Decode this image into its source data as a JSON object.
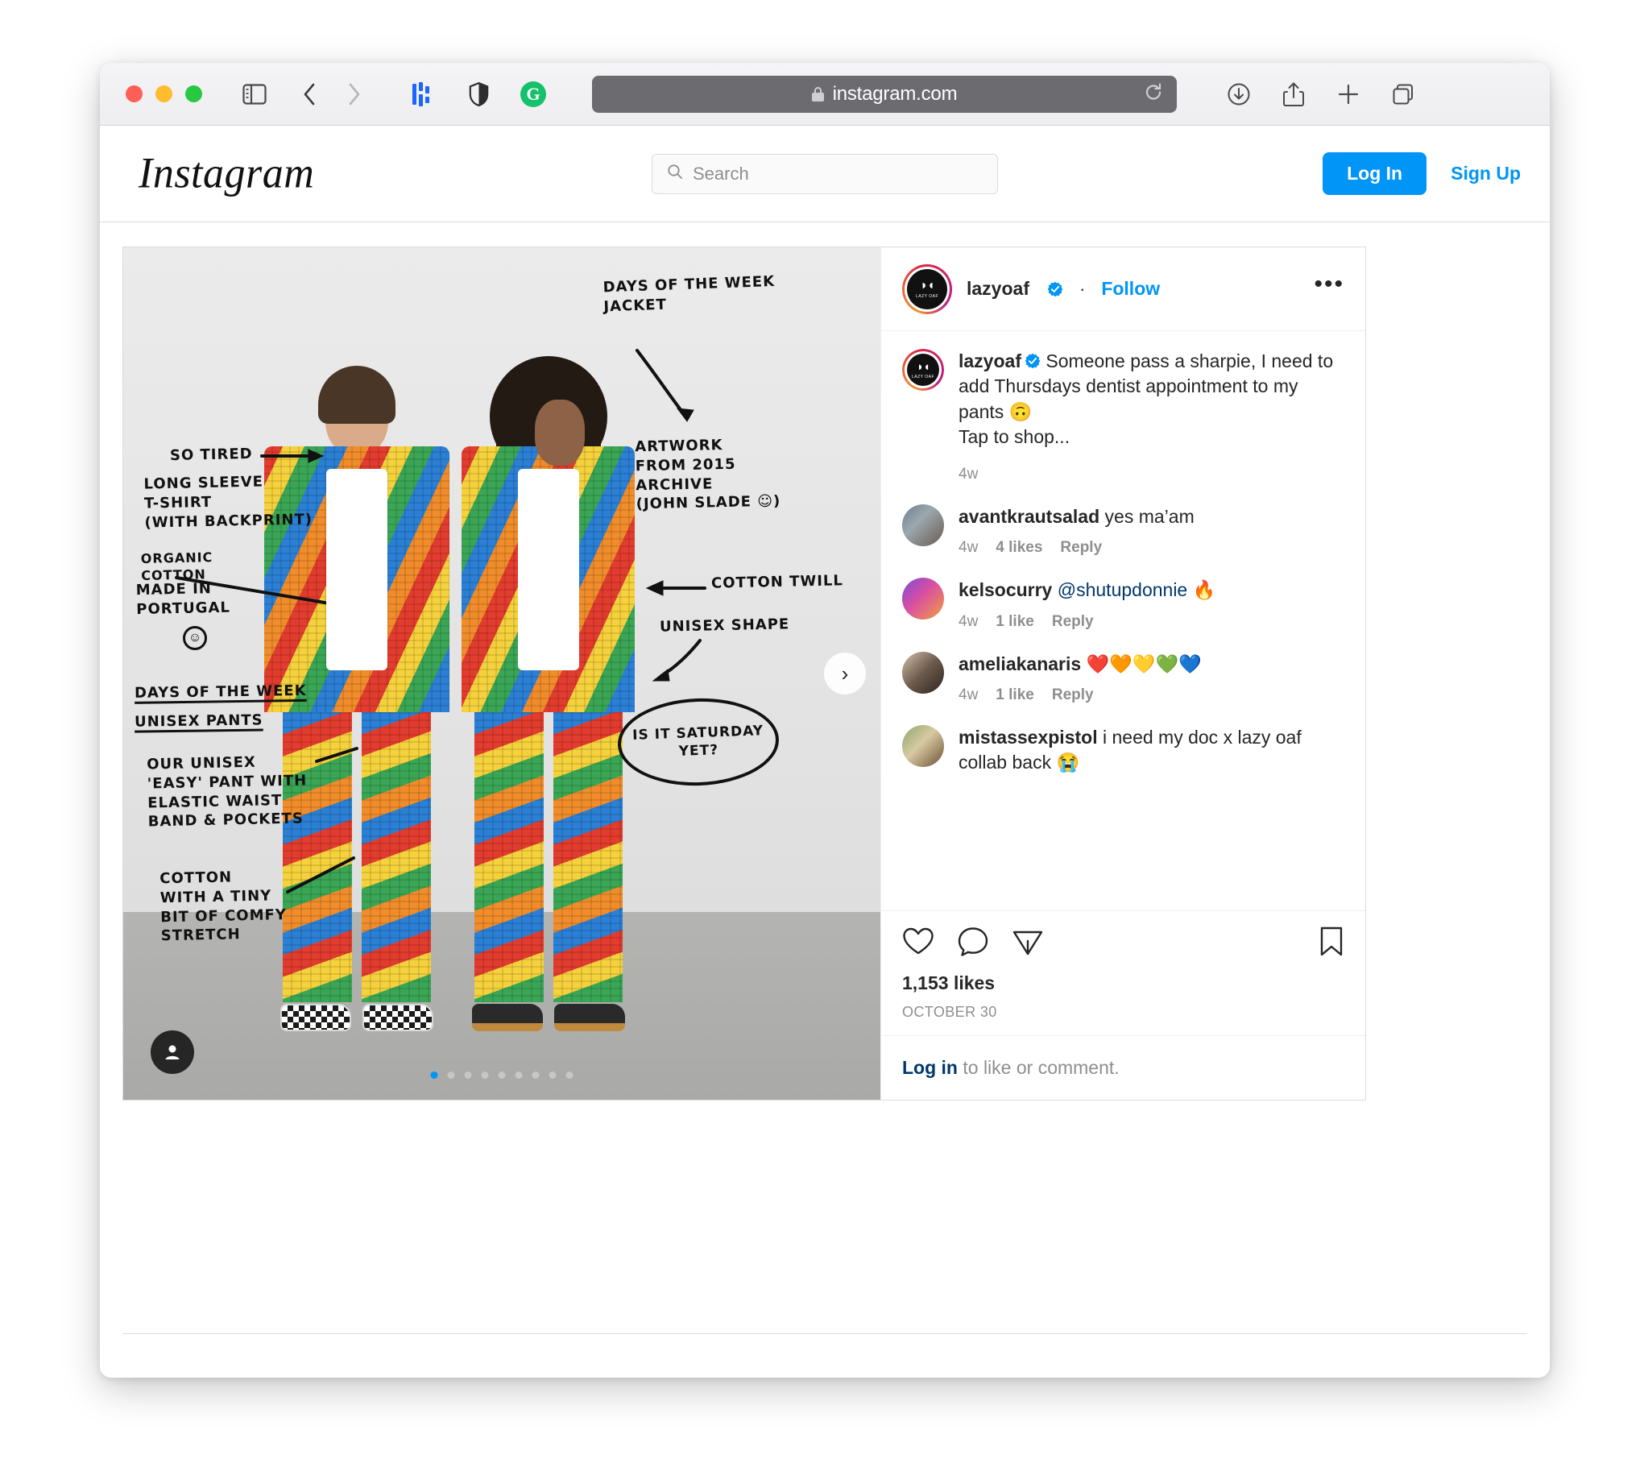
{
  "browser": {
    "url": "instagram.com",
    "traffic_lights": [
      "close",
      "minimize",
      "maximize"
    ],
    "toolbar_icons": [
      "sidebar-icon",
      "back-icon",
      "forward-icon",
      "honey-extension-icon",
      "shield-extension-icon",
      "grammarly-extension-icon",
      "lock-icon",
      "reload-icon",
      "downloads-icon",
      "share-icon",
      "new-tab-icon",
      "tab-overview-icon"
    ]
  },
  "ig_nav": {
    "logo": "Instagram",
    "search_placeholder": "Search",
    "login_label": "Log In",
    "signup_label": "Sign Up",
    "accent_blue": "#0095f6"
  },
  "post": {
    "author": {
      "username": "lazyoaf",
      "verified": true,
      "avatar_eyes": "◗◖",
      "avatar_text": "LAZY OAF"
    },
    "follow_label": "Follow",
    "separator": "·",
    "more_label": "•••",
    "caption": {
      "username": "lazyoaf",
      "text": "Someone pass a sharpie, I need to add Thursdays dentist appointment to my pants 🙃",
      "line2": "Tap to shop...",
      "time": "4w"
    },
    "comments": [
      {
        "username": "avantkrautsalad",
        "text": "yes ma’am",
        "mention": "",
        "time": "4w",
        "likes": "4 likes",
        "reply": "Reply"
      },
      {
        "username": "kelsocurry",
        "text": " 🔥",
        "mention": "@shutupdonnie",
        "time": "4w",
        "likes": "1 like",
        "reply": "Reply"
      },
      {
        "username": "ameliakanaris",
        "text": " ❤️🧡💛💚💙",
        "mention": "",
        "time": "4w",
        "likes": "1 like",
        "reply": "Reply"
      },
      {
        "username": "mistassexpistol",
        "text": "i need my doc x lazy oaf collab back 😭",
        "mention": "",
        "time": "",
        "likes": "",
        "reply": ""
      }
    ],
    "actions": [
      "like-icon",
      "comment-icon",
      "share-icon",
      "save-icon"
    ],
    "likes_count": "1,153 likes",
    "date": "OCTOBER 30",
    "login_prompt": {
      "link": "Log in",
      "rest": " to like or comment."
    },
    "carousel": {
      "total_dots": 9,
      "active_index": 0,
      "next_label": "›"
    }
  },
  "photo_annotations": {
    "days_of_week_jacket": "DAYS OF THE WEEK\nJACKET",
    "so_tired": "SO TIRED",
    "long_sleeve": "LONG SLEEVE\nT-SHIRT\n(WITH BACKPRINT)",
    "organic_cotton": "ORGANIC\nCOTTON",
    "made_in_portugal": "MADE IN\nPORTUGAL",
    "smiley": "☺",
    "days_of_week_pants_l1": "DAYS OF THE WEEK",
    "days_of_week_pants_l2": "UNISEX PANTS",
    "easy_pant": "OUR UNISEX\n'EASY' PANT WITH\nELASTIC WAIST\nBAND & POCKETS",
    "cotton_stretch": "COTTON\nWITH A TINY\nBIT OF COMFY\nSTRETCH",
    "artwork_archive": "ARTWORK\nFROM 2015\nARCHIVE\n(JOHN SLADE ☺)",
    "cotton_twill": "COTTON TWILL",
    "unisex_shape": "UNISEX SHAPE",
    "is_it_saturday": "IS IT SATURDAY\nYET?"
  }
}
